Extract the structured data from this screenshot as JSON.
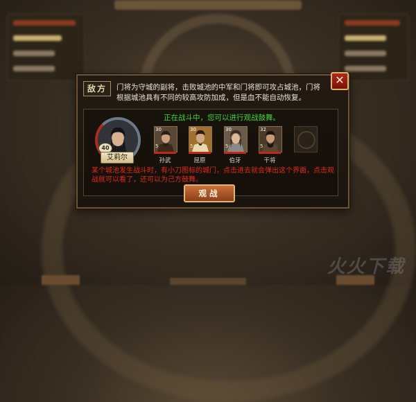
{
  "dialog": {
    "tag": "敌方",
    "description": "门将为守城的副将，击败城池的中军和门将即可攻占城池，门将根据城池具有不同的较高攻防加成，但是血不能自动恢复。",
    "status": "正在战斗中，您可以进行观战鼓舞。",
    "commander": {
      "level": "40",
      "name": "艾莉尔"
    },
    "generals": [
      {
        "level": "30",
        "stars": "5",
        "name": "孙武"
      },
      {
        "level": "30",
        "stars": "5",
        "name": "屈原"
      },
      {
        "level": "30",
        "stars": "5",
        "name": "伯牙"
      },
      {
        "level": "32",
        "stars": "5",
        "name": "干将"
      }
    ],
    "tip": "某个城池发生战斗时，有小刀图标的城门，点击进去就会弹出这个界面，点击观战就可以看了，还可以为己方鼓舞。",
    "watch_button": "观战",
    "close_glyph": "✕"
  },
  "colors": {
    "status_green": "#46d43a",
    "tip_red": "#e22a1a",
    "accent_gold": "#d8b46a"
  },
  "icons": {
    "close": "close-icon",
    "empty_slot": "seal-icon"
  }
}
